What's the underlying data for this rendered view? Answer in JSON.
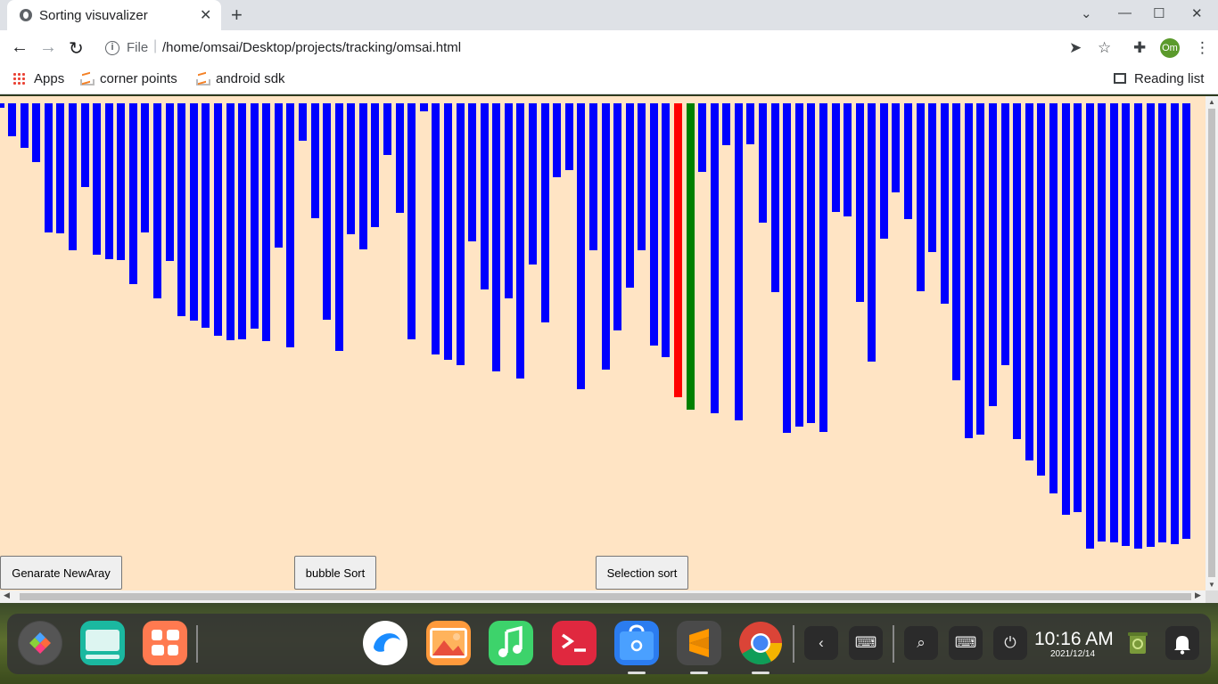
{
  "browser": {
    "tab_title": "Sorting visuvalizer",
    "url_scheme": "File",
    "url": "/home/omsai/Desktop/projects/tracking/omsai.html",
    "profile_initials": "Om",
    "bookmarks": [
      {
        "label": "Apps",
        "icon": "apps-grid-icon"
      },
      {
        "label": "corner points",
        "icon": "stackoverflow-icon"
      },
      {
        "label": "android sdk",
        "icon": "stackoverflow-icon"
      }
    ],
    "reading_list_label": "Reading list"
  },
  "page": {
    "background_color": "#ffe4c4",
    "bar_color": "#0000ff",
    "compare_color": "#ff0000",
    "current_color": "#008000",
    "bar_heights": [
      5,
      37,
      50,
      66,
      145,
      146,
      165,
      94,
      170,
      175,
      176,
      203,
      145,
      219,
      177,
      239,
      244,
      252,
      261,
      266,
      265,
      253,
      267,
      162,
      274,
      42,
      129,
      243,
      278,
      147,
      164,
      139,
      58,
      123,
      265,
      9,
      282,
      288,
      294,
      155,
      209,
      301,
      219,
      309,
      181,
      246,
      83,
      75,
      321,
      165,
      299,
      255,
      207,
      165,
      272,
      285,
      330,
      344,
      77,
      348,
      47,
      356,
      46,
      134,
      212,
      370,
      363,
      359,
      369,
      122,
      127,
      223,
      290,
      152,
      100,
      130,
      211,
      167,
      225,
      311,
      376,
      372,
      340,
      294,
      377,
      401,
      418,
      438,
      462,
      459,
      500,
      492,
      493,
      497,
      500,
      498,
      493,
      495,
      489
    ],
    "compare_index": 56,
    "current_index": 57,
    "buttons": {
      "generate": "Genarate NewAray",
      "bubble": "bubble Sort",
      "selection": "Selection sort"
    }
  },
  "taskbar": {
    "time": "10:16 AM",
    "date": "2021/12/14"
  }
}
